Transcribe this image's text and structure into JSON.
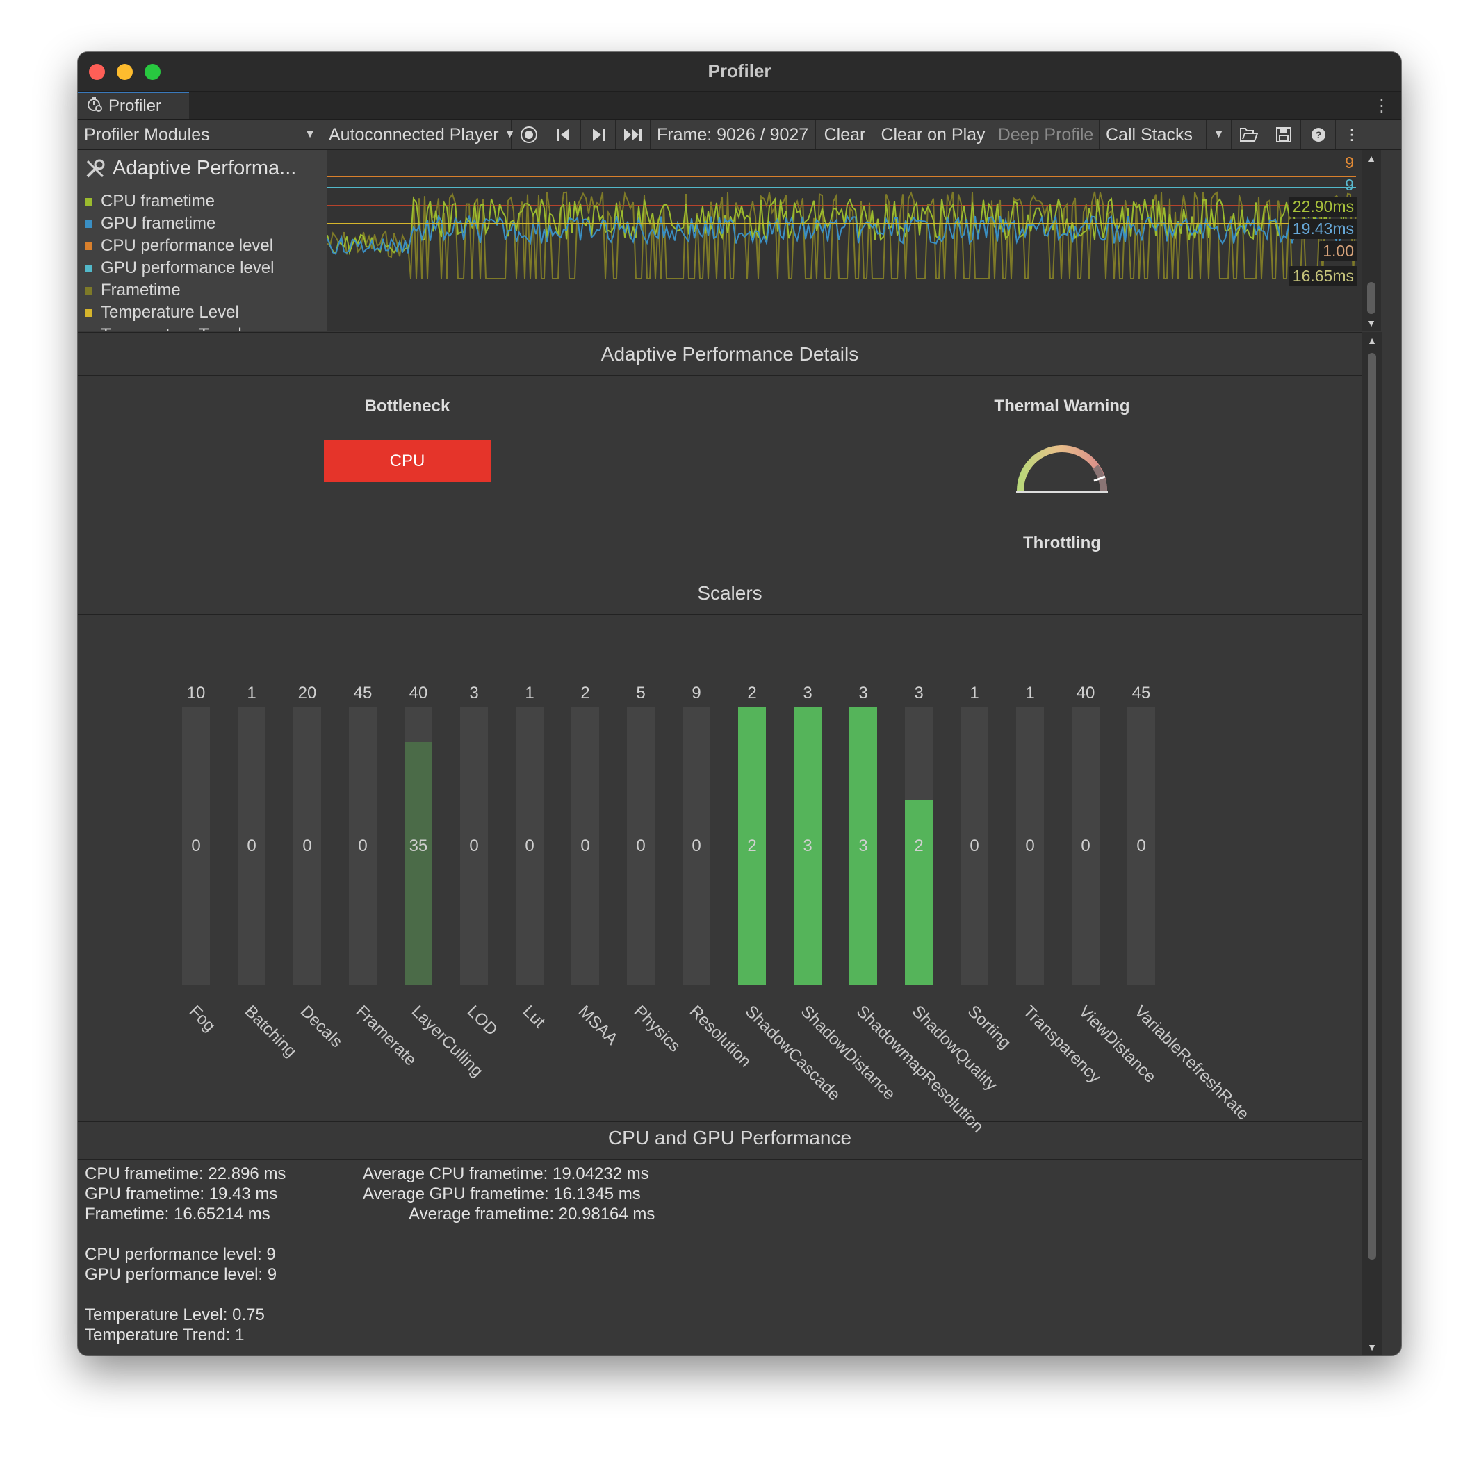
{
  "window": {
    "title": "Profiler"
  },
  "tab": {
    "label": "Profiler"
  },
  "toolbar": {
    "modules_dropdown": "Profiler Modules",
    "target_dropdown": "Autoconnected Player",
    "frame_label": "Frame: 9026 / 9027",
    "clear": "Clear",
    "clear_on_play": "Clear on Play",
    "deep_profile": "Deep Profile",
    "call_stacks": "Call Stacks"
  },
  "module": {
    "title": "Adaptive Performa...",
    "legend": [
      {
        "label": "CPU frametime",
        "color": "#9bbb2e"
      },
      {
        "label": "GPU frametime",
        "color": "#3a8fc4"
      },
      {
        "label": "CPU performance level",
        "color": "#d9802c"
      },
      {
        "label": "GPU performance level",
        "color": "#52b8c9"
      },
      {
        "label": "Frametime",
        "color": "#7e7a28"
      },
      {
        "label": "Temperature Level",
        "color": "#d6b52c"
      },
      {
        "label": "Temperature Trend",
        "color": "#b6432c"
      }
    ]
  },
  "chart_values": {
    "cpu_level_top": "9",
    "gpu_level_top": "9",
    "cpu_frametime": "22.90ms",
    "gpu_frametime": "19.43ms",
    "temperature": "1.00",
    "frametime": "16.65ms"
  },
  "details": {
    "header": "Adaptive Performance Details",
    "bottleneck_label": "Bottleneck",
    "bottleneck_value": "CPU",
    "thermal_label": "Thermal Warning",
    "thermal_state": "Throttling"
  },
  "scalers": {
    "header": "Scalers",
    "items": [
      {
        "name": "Fog",
        "max": "10",
        "current": "0",
        "fill": 0,
        "state": "off"
      },
      {
        "name": "Batching",
        "max": "1",
        "current": "0",
        "fill": 0,
        "state": "off"
      },
      {
        "name": "Decals",
        "max": "20",
        "current": "0",
        "fill": 0,
        "state": "off"
      },
      {
        "name": "Framerate",
        "max": "45",
        "current": "0",
        "fill": 0,
        "state": "off"
      },
      {
        "name": "LayerCulling",
        "max": "40",
        "current": "35",
        "fill": 0.875,
        "state": "dim"
      },
      {
        "name": "LOD",
        "max": "3",
        "current": "0",
        "fill": 0,
        "state": "off"
      },
      {
        "name": "Lut",
        "max": "1",
        "current": "0",
        "fill": 0,
        "state": "off"
      },
      {
        "name": "MSAA",
        "max": "2",
        "current": "0",
        "fill": 0,
        "state": "off"
      },
      {
        "name": "Physics",
        "max": "5",
        "current": "0",
        "fill": 0,
        "state": "off"
      },
      {
        "name": "Resolution",
        "max": "9",
        "current": "0",
        "fill": 0,
        "state": "off"
      },
      {
        "name": "ShadowCascade",
        "max": "2",
        "current": "2",
        "fill": 1.0,
        "state": "on"
      },
      {
        "name": "ShadowDistance",
        "max": "3",
        "current": "3",
        "fill": 1.0,
        "state": "on"
      },
      {
        "name": "ShadowmapResolution",
        "max": "3",
        "current": "3",
        "fill": 1.0,
        "state": "on"
      },
      {
        "name": "ShadowQuality",
        "max": "3",
        "current": "2",
        "fill": 0.667,
        "state": "on"
      },
      {
        "name": "Sorting",
        "max": "1",
        "current": "0",
        "fill": 0,
        "state": "off"
      },
      {
        "name": "Transparency",
        "max": "1",
        "current": "0",
        "fill": 0,
        "state": "off"
      },
      {
        "name": "ViewDistance",
        "max": "40",
        "current": "0",
        "fill": 0,
        "state": "off"
      },
      {
        "name": "VariableRefreshRate",
        "max": "45",
        "current": "0",
        "fill": 0,
        "state": "off"
      }
    ]
  },
  "performance": {
    "header": "CPU and GPU Performance",
    "cpu_frametime": "CPU frametime: 22.896 ms",
    "gpu_frametime": "GPU frametime: 19.43 ms",
    "frametime": "Frametime: 16.65214 ms",
    "avg_cpu": "Average CPU frametime: 19.04232 ms",
    "avg_gpu": "Average GPU frametime: 16.1345 ms",
    "avg_frame": "Average frametime: 20.98164 ms",
    "cpu_level": "CPU performance level: 9",
    "gpu_level": "GPU performance level: 9",
    "temp_level": "Temperature Level: 0.75",
    "temp_trend": "Temperature Trend: 1"
  }
}
